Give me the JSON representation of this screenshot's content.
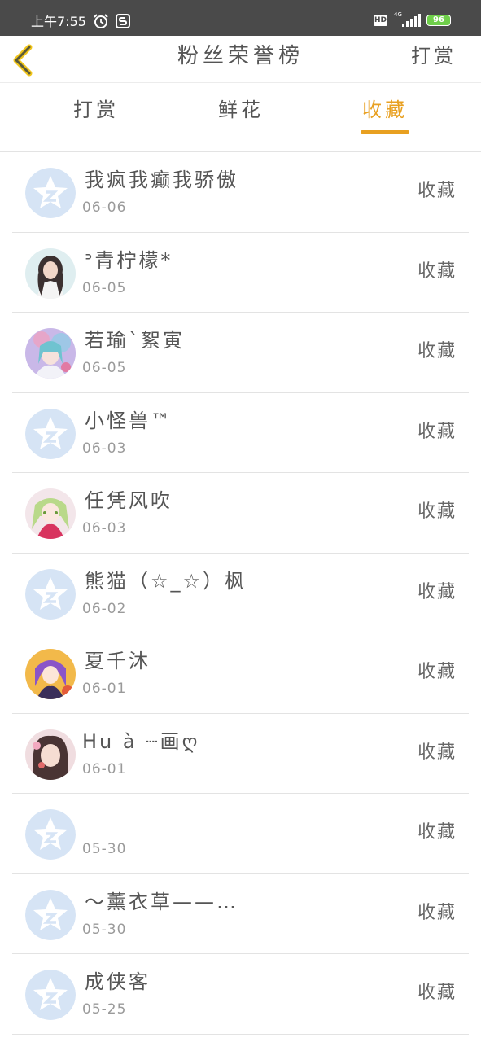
{
  "status_bar": {
    "time": "上午7:55",
    "hd": "HD",
    "network": "4G",
    "battery": "96",
    "icons": [
      "alarm-icon",
      "app-s-icon",
      "signal-icon",
      "battery-icon"
    ]
  },
  "header": {
    "title": "粉丝荣誉榜",
    "right_action": "打赏",
    "back_icon": "chevron-left-icon"
  },
  "tabs": [
    {
      "label": "打赏",
      "active": false
    },
    {
      "label": "鲜花",
      "active": false
    },
    {
      "label": "收藏",
      "active": true
    }
  ],
  "colors": {
    "accent": "#e8a021",
    "text": "#555555",
    "muted": "#9a9a9a",
    "default_avatar": "#d6e4f5"
  },
  "list": [
    {
      "name": "我疯我癫我骄傲",
      "date": "06-06",
      "action": "收藏",
      "avatar": "default-avatar-icon"
    },
    {
      "name": "ᐣ青柠檬*",
      "date": "06-05",
      "action": "收藏",
      "avatar": "user-photo"
    },
    {
      "name": "若瑜`絮寅",
      "date": "06-05",
      "action": "收藏",
      "avatar": "anime-avatar"
    },
    {
      "name": "小怪兽™",
      "date": "06-03",
      "action": "收藏",
      "avatar": "default-avatar-icon"
    },
    {
      "name": "任凭风吹",
      "date": "06-03",
      "action": "收藏",
      "avatar": "anime-avatar"
    },
    {
      "name": "熊猫（☆_☆）枫",
      "date": "06-02",
      "action": "收藏",
      "avatar": "default-avatar-icon"
    },
    {
      "name": "夏千沐",
      "date": "06-01",
      "action": "收藏",
      "avatar": "anime-avatar"
    },
    {
      "name": "Hu à ┈画ღ",
      "date": "06-01",
      "action": "收藏",
      "avatar": "user-photo"
    },
    {
      "name": "",
      "date": "05-30",
      "action": "收藏",
      "avatar": "default-avatar-icon"
    },
    {
      "name": "～薰衣草——…",
      "date": "05-30",
      "action": "收藏",
      "avatar": "default-avatar-icon"
    },
    {
      "name": "成侠客",
      "date": "05-25",
      "action": "收藏",
      "avatar": "default-avatar-icon"
    }
  ]
}
